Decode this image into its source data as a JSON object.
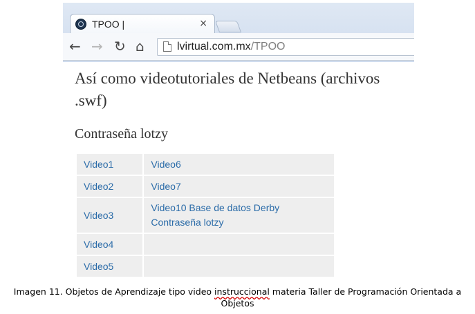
{
  "browser": {
    "tab_title": "TPOO |",
    "tab_close": "×",
    "url_domain": "lvirtual.com.mx",
    "url_path": "/TPOO",
    "nav": {
      "back": "←",
      "forward": "→",
      "reload": "↻",
      "home": "⌂"
    }
  },
  "page": {
    "heading": "Así como videotutoriales de Netbeans (archivos .swf)",
    "password_heading": "Contraseña lotzy",
    "table": {
      "rows": [
        {
          "col1": "Video1",
          "col2": [
            "Video6"
          ]
        },
        {
          "col1": "Video2",
          "col2": [
            "Video7"
          ]
        },
        {
          "col1": "Video3",
          "col2": [
            "Video10 Base de datos Derby",
            "Contraseña lotzy"
          ]
        },
        {
          "col1": "Video4",
          "col2": []
        },
        {
          "col1": "Video5",
          "col2": []
        }
      ]
    }
  },
  "caption": {
    "before": "Imagen 11. Objetos de Aprendizaje tipo video ",
    "underlined": "instruccional",
    "after": " materia Taller de Programación Orientada a Objetos"
  },
  "colors": {
    "link": "#2a6ba8",
    "cell_bg": "#eeeeee",
    "heading_text": "#333333",
    "spellcheck_underline": "#d40000"
  }
}
